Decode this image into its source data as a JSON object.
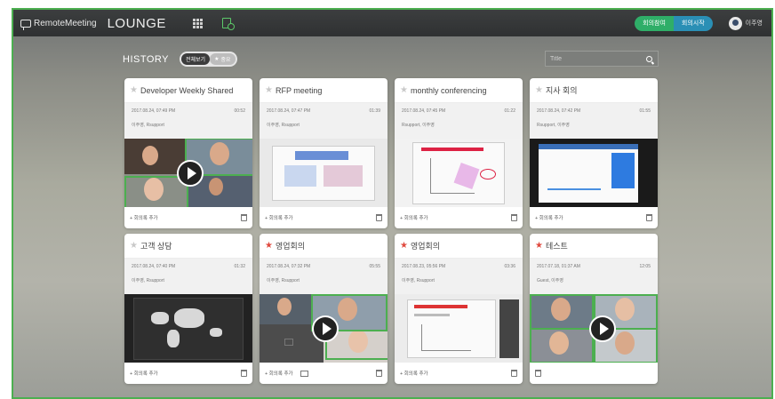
{
  "app": {
    "brand": "RemoteMeeting",
    "section": "LOUNGE"
  },
  "topbar": {
    "btn_meeting": "회의참여",
    "btn_start": "회의시작",
    "user_name": "이주영"
  },
  "history": {
    "title": "HISTORY",
    "toggle_all": "전체보기",
    "toggle_star": "중요"
  },
  "search": {
    "placeholder": "Title"
  },
  "cards": [
    {
      "title": "Developer Weekly Shared",
      "starred": false,
      "date": "2017.08.24, 07:49 PM",
      "duration": "00:52",
      "people": "이주영, Rsupport",
      "add_label": "+ 회의록 추가"
    },
    {
      "title": "RFP meeting",
      "starred": false,
      "date": "2017.08.24, 07:47 PM",
      "duration": "01:39",
      "people": "이주영, Rsupport",
      "add_label": "+ 회의록 추가"
    },
    {
      "title": "monthly conferencing",
      "starred": false,
      "date": "2017.08.24, 07:45 PM",
      "duration": "01:22",
      "people": "Rsupport, 이주영",
      "add_label": "+ 회의록 추가"
    },
    {
      "title": "지사 회의",
      "starred": false,
      "date": "2017.08.24, 07:42 PM",
      "duration": "01:55",
      "people": "Rsupport, 이주영",
      "add_label": "+ 회의록 추가"
    },
    {
      "title": "고객 상담",
      "starred": false,
      "date": "2017.08.24, 07:40 PM",
      "duration": "01:32",
      "people": "이주영, Rsupport",
      "add_label": "+ 회의록 추가"
    },
    {
      "title": "영업회의",
      "starred": true,
      "date": "2017.08.24, 07:32 PM",
      "duration": "05:55",
      "people": "이주영, Rsupport",
      "add_label": "+ 회의록 추가"
    },
    {
      "title": "영업회의",
      "starred": true,
      "date": "2017.08.23, 05:56 PM",
      "duration": "03:36",
      "people": "이주영, Rsupport",
      "add_label": "+ 회의록 추가"
    },
    {
      "title": "테스트",
      "starred": true,
      "date": "2017.07.18, 01:37 AM",
      "duration": "12:05",
      "people": "Guest, 이주영",
      "add_label": ""
    }
  ],
  "colors": {
    "accent_green": "#4caf50",
    "star_red": "#e04a3f",
    "join_button": "#2fae68",
    "start_button": "#2a8fb5"
  }
}
